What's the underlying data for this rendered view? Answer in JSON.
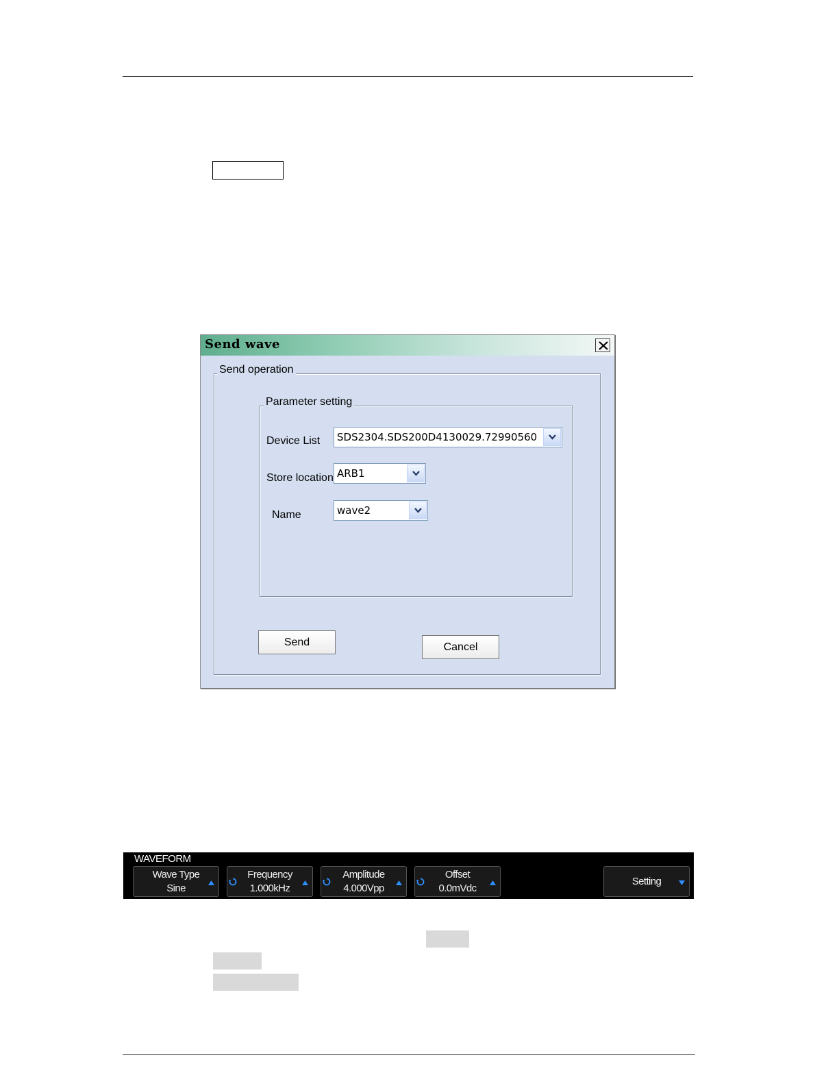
{
  "dialog": {
    "title": "Send wave",
    "close_glyph": "✕",
    "send_operation_label": "Send operation",
    "parameter_setting_label": "Parameter  setting",
    "device_list_label": "Device List",
    "device_list_value": "SDS2304.SDS200D4130029.72990560",
    "store_location_label": "Store location",
    "store_location_value": "ARB1",
    "name_label": "Name",
    "name_value": "wave2",
    "send_button": "Send",
    "cancel_button": "Cancel"
  },
  "waveform_bar": {
    "title": "WAVEFORM",
    "softkeys": [
      {
        "line1": "Wave Type",
        "line2": "Sine",
        "arrow": "up"
      },
      {
        "line1": "Frequency",
        "line2": "1.000kHz",
        "arrow": "up",
        "knob": true
      },
      {
        "line1": "Amplitude",
        "line2": "4.000Vpp",
        "arrow": "up",
        "knob": true
      },
      {
        "line1": "Offset",
        "line2": "0.0mVdc",
        "arrow": "up",
        "knob": true
      },
      {
        "line1": "Setting",
        "arrow": "down"
      }
    ]
  },
  "colors": {
    "dialog_bg": "#d4def0",
    "title_gradient_start": "#5fae8e",
    "accent_arrow": "#2f8fff",
    "bar_bg": "#000000"
  }
}
